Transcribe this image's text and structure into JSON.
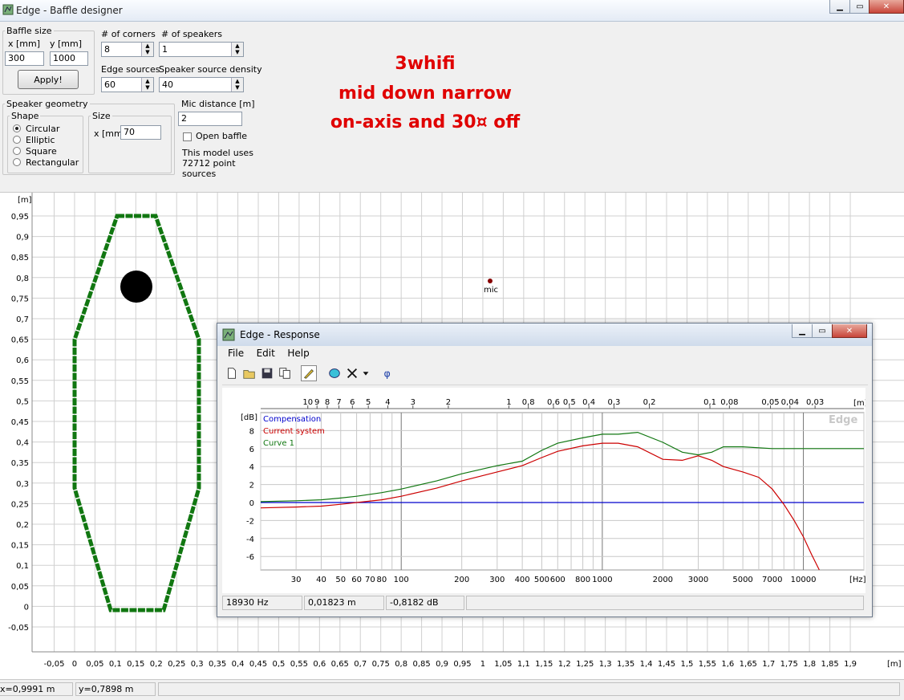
{
  "window": {
    "title": "Edge - Baffle designer",
    "minimize": "▁",
    "maximize": "▭",
    "close": "✕"
  },
  "baffle_size": {
    "legend": "Baffle size",
    "x_label": "x [mm]",
    "y_label": "y [mm]",
    "x_value": "300",
    "y_value": "1000",
    "apply_label": "Apply!"
  },
  "corners": {
    "label": "# of corners",
    "value": "8"
  },
  "speakers": {
    "label": "# of speakers",
    "value": "1"
  },
  "edge_sources": {
    "label": "Edge sources",
    "value": "60"
  },
  "speaker_density": {
    "label": "Speaker source density",
    "value": "40"
  },
  "speaker_geometry": {
    "legend": "Speaker geometry",
    "shape_legend": "Shape",
    "shapes": [
      "Circular",
      "Elliptic",
      "Square",
      "Rectangular"
    ],
    "selected_shape": 0,
    "size_legend": "Size",
    "size_label": "x [mm]",
    "size_value": "70"
  },
  "mic_distance": {
    "label": "Mic distance [m]",
    "value": "2"
  },
  "open_baffle": {
    "label": "Open baffle",
    "checked": false
  },
  "model_info": {
    "line1": "This model uses",
    "line2": "72712 point",
    "line3": "sources"
  },
  "annotation": {
    "line1": "3whifi",
    "line2": "mid down narrow",
    "line3": "on-axis and 30¤ off",
    "color": "#e00000"
  },
  "baffle_plot": {
    "y_unit": "[m]",
    "x_unit": "[m]",
    "y_ticks": [
      "0,95",
      "0,9",
      "0,85",
      "0,8",
      "0,75",
      "0,7",
      "0,65",
      "0,6",
      "0,55",
      "0,5",
      "0,45",
      "0,4",
      "0,35",
      "0,3",
      "0,25",
      "0,2",
      "0,15",
      "0,1",
      "0,05",
      "0",
      "-0,05"
    ],
    "x_ticks": [
      "-0,05",
      "0",
      "0,05",
      "0,1",
      "0,15",
      "0,2",
      "0,25",
      "0,3",
      "0,35",
      "0,4",
      "0,45",
      "0,5",
      "0,55",
      "0,6",
      "0,65",
      "0,7",
      "0,75",
      "0,8",
      "0,85",
      "0,9",
      "0,95",
      "1",
      "1,05",
      "1,1",
      "1,15",
      "1,2",
      "1,25",
      "1,3",
      "1,35",
      "1,4",
      "1,45",
      "1,5",
      "1,55",
      "1,6",
      "1,65",
      "1,7",
      "1,75",
      "1,8",
      "1,85",
      "1,9"
    ],
    "baffle_color": "#117711",
    "mic_label": "mic",
    "mic_color": "#880000"
  },
  "status": {
    "x": "x=0,9991 m",
    "y": "y=0,7898 m"
  },
  "response_window": {
    "title": "Edge - Response",
    "menus": [
      "File",
      "Edit",
      "Help"
    ],
    "toolbar_icons": [
      "new-file-icon",
      "open-folder-icon",
      "save-icon",
      "copy-icon",
      "pencil-icon",
      "speaker-icon",
      "delete-icon",
      "dropdown-arrow-icon",
      "phase-icon"
    ],
    "phase_glyph": "φ",
    "watermark": "Edge",
    "status": {
      "freq": "18930 Hz",
      "dist": "0,01823 m",
      "level": "-0,8182 dB"
    }
  },
  "chart_data": {
    "type": "line",
    "title": "",
    "xlabel": "[Hz]",
    "ylabel": "[dB]",
    "x_scale": "log",
    "xlim": [
      20,
      20000
    ],
    "ylim": [
      -7.5,
      10
    ],
    "grid": true,
    "legend_position": "top-left",
    "x_tick_labels": [
      "30",
      "40",
      "50",
      "60",
      "70",
      "80",
      "100",
      "200",
      "300",
      "400",
      "500",
      "600",
      "800",
      "1000",
      "2000",
      "3000",
      "5000",
      "7000",
      "10000"
    ],
    "y_tick_labels": [
      "8",
      "6",
      "4",
      "2",
      "0",
      "-2",
      "-4",
      "-6"
    ],
    "top_axis_label": "[m]",
    "top_axis_ticks": [
      "10",
      "9",
      "8",
      "7",
      "6",
      "5",
      "4",
      "3",
      "2",
      "1",
      "0,8",
      "0,6",
      "0,5",
      "0,4",
      "0,3",
      "0,2",
      "0,1",
      "0,08",
      "0,05",
      "0,04",
      "0,03"
    ],
    "series": [
      {
        "name": "Compensation",
        "color": "#0000cc",
        "x": [
          20,
          20000
        ],
        "y": [
          0,
          0
        ]
      },
      {
        "name": "Current system",
        "color": "#cc0000",
        "x": [
          20,
          30,
          40,
          50,
          60,
          80,
          100,
          150,
          200,
          300,
          400,
          500,
          600,
          800,
          1000,
          1200,
          1500,
          2000,
          2500,
          3000,
          3500,
          4000,
          5000,
          6000,
          7000,
          8000,
          9000,
          10000,
          11000,
          12000
        ],
        "y": [
          -0.6,
          -0.5,
          -0.4,
          -0.2,
          0,
          0.3,
          0.7,
          1.6,
          2.4,
          3.4,
          4.1,
          5.0,
          5.7,
          6.3,
          6.6,
          6.6,
          6.2,
          4.8,
          4.7,
          5.2,
          4.7,
          4.0,
          3.4,
          2.8,
          1.5,
          -0.2,
          -2.0,
          -3.8,
          -5.8,
          -7.5
        ]
      },
      {
        "name": "Curve 1",
        "color": "#117711",
        "x": [
          20,
          30,
          40,
          50,
          60,
          80,
          100,
          150,
          200,
          300,
          400,
          500,
          600,
          800,
          1000,
          1200,
          1500,
          2000,
          2500,
          3000,
          3500,
          4000,
          5000,
          7000,
          10000,
          15000,
          20000
        ],
        "y": [
          0.1,
          0.2,
          0.3,
          0.5,
          0.7,
          1.1,
          1.5,
          2.4,
          3.2,
          4.1,
          4.6,
          5.8,
          6.6,
          7.2,
          7.6,
          7.6,
          7.8,
          6.7,
          5.6,
          5.3,
          5.6,
          6.2,
          6.2,
          6.0,
          6.0,
          6.0,
          6.0
        ]
      }
    ]
  }
}
